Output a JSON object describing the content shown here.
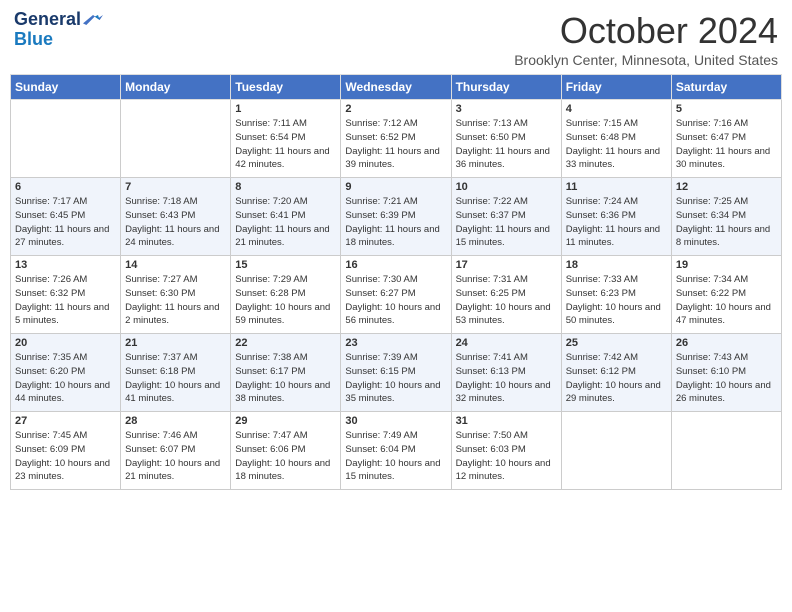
{
  "header": {
    "logo_general": "General",
    "logo_blue": "Blue",
    "title": "October 2024",
    "location": "Brooklyn Center, Minnesota, United States"
  },
  "days_of_week": [
    "Sunday",
    "Monday",
    "Tuesday",
    "Wednesday",
    "Thursday",
    "Friday",
    "Saturday"
  ],
  "weeks": [
    [
      {
        "day": "",
        "info": ""
      },
      {
        "day": "",
        "info": ""
      },
      {
        "day": "1",
        "info": "Sunrise: 7:11 AM\nSunset: 6:54 PM\nDaylight: 11 hours and 42 minutes."
      },
      {
        "day": "2",
        "info": "Sunrise: 7:12 AM\nSunset: 6:52 PM\nDaylight: 11 hours and 39 minutes."
      },
      {
        "day": "3",
        "info": "Sunrise: 7:13 AM\nSunset: 6:50 PM\nDaylight: 11 hours and 36 minutes."
      },
      {
        "day": "4",
        "info": "Sunrise: 7:15 AM\nSunset: 6:48 PM\nDaylight: 11 hours and 33 minutes."
      },
      {
        "day": "5",
        "info": "Sunrise: 7:16 AM\nSunset: 6:47 PM\nDaylight: 11 hours and 30 minutes."
      }
    ],
    [
      {
        "day": "6",
        "info": "Sunrise: 7:17 AM\nSunset: 6:45 PM\nDaylight: 11 hours and 27 minutes."
      },
      {
        "day": "7",
        "info": "Sunrise: 7:18 AM\nSunset: 6:43 PM\nDaylight: 11 hours and 24 minutes."
      },
      {
        "day": "8",
        "info": "Sunrise: 7:20 AM\nSunset: 6:41 PM\nDaylight: 11 hours and 21 minutes."
      },
      {
        "day": "9",
        "info": "Sunrise: 7:21 AM\nSunset: 6:39 PM\nDaylight: 11 hours and 18 minutes."
      },
      {
        "day": "10",
        "info": "Sunrise: 7:22 AM\nSunset: 6:37 PM\nDaylight: 11 hours and 15 minutes."
      },
      {
        "day": "11",
        "info": "Sunrise: 7:24 AM\nSunset: 6:36 PM\nDaylight: 11 hours and 11 minutes."
      },
      {
        "day": "12",
        "info": "Sunrise: 7:25 AM\nSunset: 6:34 PM\nDaylight: 11 hours and 8 minutes."
      }
    ],
    [
      {
        "day": "13",
        "info": "Sunrise: 7:26 AM\nSunset: 6:32 PM\nDaylight: 11 hours and 5 minutes."
      },
      {
        "day": "14",
        "info": "Sunrise: 7:27 AM\nSunset: 6:30 PM\nDaylight: 11 hours and 2 minutes."
      },
      {
        "day": "15",
        "info": "Sunrise: 7:29 AM\nSunset: 6:28 PM\nDaylight: 10 hours and 59 minutes."
      },
      {
        "day": "16",
        "info": "Sunrise: 7:30 AM\nSunset: 6:27 PM\nDaylight: 10 hours and 56 minutes."
      },
      {
        "day": "17",
        "info": "Sunrise: 7:31 AM\nSunset: 6:25 PM\nDaylight: 10 hours and 53 minutes."
      },
      {
        "day": "18",
        "info": "Sunrise: 7:33 AM\nSunset: 6:23 PM\nDaylight: 10 hours and 50 minutes."
      },
      {
        "day": "19",
        "info": "Sunrise: 7:34 AM\nSunset: 6:22 PM\nDaylight: 10 hours and 47 minutes."
      }
    ],
    [
      {
        "day": "20",
        "info": "Sunrise: 7:35 AM\nSunset: 6:20 PM\nDaylight: 10 hours and 44 minutes."
      },
      {
        "day": "21",
        "info": "Sunrise: 7:37 AM\nSunset: 6:18 PM\nDaylight: 10 hours and 41 minutes."
      },
      {
        "day": "22",
        "info": "Sunrise: 7:38 AM\nSunset: 6:17 PM\nDaylight: 10 hours and 38 minutes."
      },
      {
        "day": "23",
        "info": "Sunrise: 7:39 AM\nSunset: 6:15 PM\nDaylight: 10 hours and 35 minutes."
      },
      {
        "day": "24",
        "info": "Sunrise: 7:41 AM\nSunset: 6:13 PM\nDaylight: 10 hours and 32 minutes."
      },
      {
        "day": "25",
        "info": "Sunrise: 7:42 AM\nSunset: 6:12 PM\nDaylight: 10 hours and 29 minutes."
      },
      {
        "day": "26",
        "info": "Sunrise: 7:43 AM\nSunset: 6:10 PM\nDaylight: 10 hours and 26 minutes."
      }
    ],
    [
      {
        "day": "27",
        "info": "Sunrise: 7:45 AM\nSunset: 6:09 PM\nDaylight: 10 hours and 23 minutes."
      },
      {
        "day": "28",
        "info": "Sunrise: 7:46 AM\nSunset: 6:07 PM\nDaylight: 10 hours and 21 minutes."
      },
      {
        "day": "29",
        "info": "Sunrise: 7:47 AM\nSunset: 6:06 PM\nDaylight: 10 hours and 18 minutes."
      },
      {
        "day": "30",
        "info": "Sunrise: 7:49 AM\nSunset: 6:04 PM\nDaylight: 10 hours and 15 minutes."
      },
      {
        "day": "31",
        "info": "Sunrise: 7:50 AM\nSunset: 6:03 PM\nDaylight: 10 hours and 12 minutes."
      },
      {
        "day": "",
        "info": ""
      },
      {
        "day": "",
        "info": ""
      }
    ]
  ]
}
